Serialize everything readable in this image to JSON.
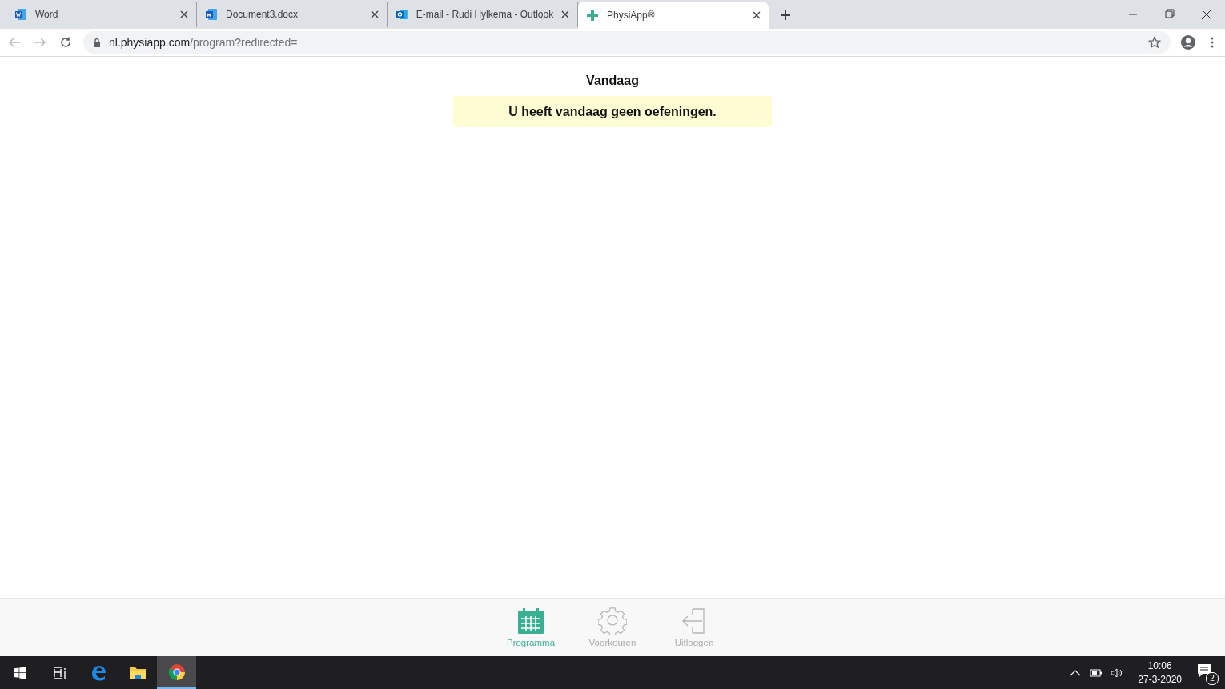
{
  "browser": {
    "tabs": [
      {
        "title": "Word",
        "kind": "word",
        "selected": false
      },
      {
        "title": "Document3.docx",
        "kind": "word",
        "selected": false
      },
      {
        "title": "E-mail - Rudi Hylkema - Outlook",
        "kind": "outlook",
        "selected": false
      },
      {
        "title": "PhysiApp®",
        "kind": "physiapp",
        "selected": true
      }
    ],
    "url_host": "nl.physiapp.com",
    "url_path": "/program?redirected="
  },
  "page": {
    "heading": "Vandaag",
    "notice": "U heeft vandaag geen oefeningen."
  },
  "bottom_nav": [
    {
      "label": "Programma",
      "kind": "calendar",
      "selected": true
    },
    {
      "label": "Voorkeuren",
      "kind": "gear",
      "selected": false
    },
    {
      "label": "Uitloggen",
      "kind": "logout",
      "selected": false
    }
  ],
  "taskbar": {
    "apps": [
      {
        "kind": "taskview",
        "selected": false
      },
      {
        "kind": "edge",
        "selected": false
      },
      {
        "kind": "explorer",
        "selected": false
      },
      {
        "kind": "chrome",
        "selected": true
      }
    ],
    "time": "10:06",
    "date": "27-3-2020",
    "notifications": "2"
  }
}
